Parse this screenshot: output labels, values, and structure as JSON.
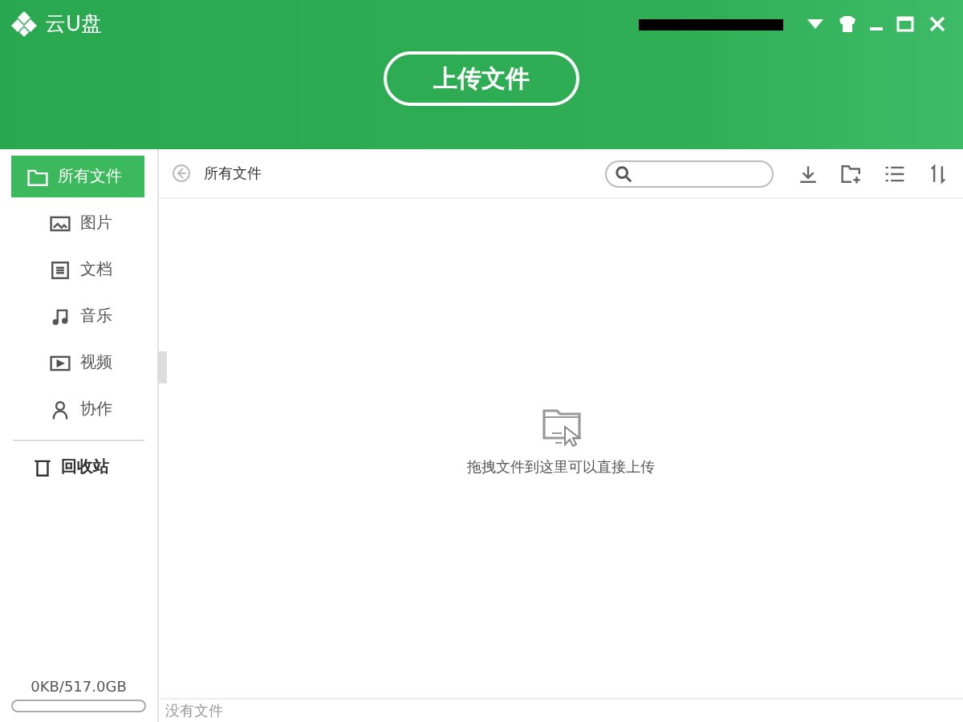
{
  "app": {
    "title": "云U盘"
  },
  "upload_button": {
    "label": "上传文件"
  },
  "sidebar": {
    "items": [
      {
        "label": "所有文件",
        "kind": "folder",
        "selected": true
      },
      {
        "label": "图片",
        "kind": "image",
        "selected": false
      },
      {
        "label": "文档",
        "kind": "doc",
        "selected": false
      },
      {
        "label": "音乐",
        "kind": "music",
        "selected": false
      },
      {
        "label": "视频",
        "kind": "video",
        "selected": false
      },
      {
        "label": "协作",
        "kind": "user",
        "selected": false
      }
    ],
    "trash": {
      "label": "回收站"
    },
    "storage": {
      "text": "0KB/517.0GB",
      "level": 0
    }
  },
  "breadcrumb": "所有文件",
  "empty_hint": "拖拽文件到这里可以直接上传",
  "status_bar": "没有文件"
}
